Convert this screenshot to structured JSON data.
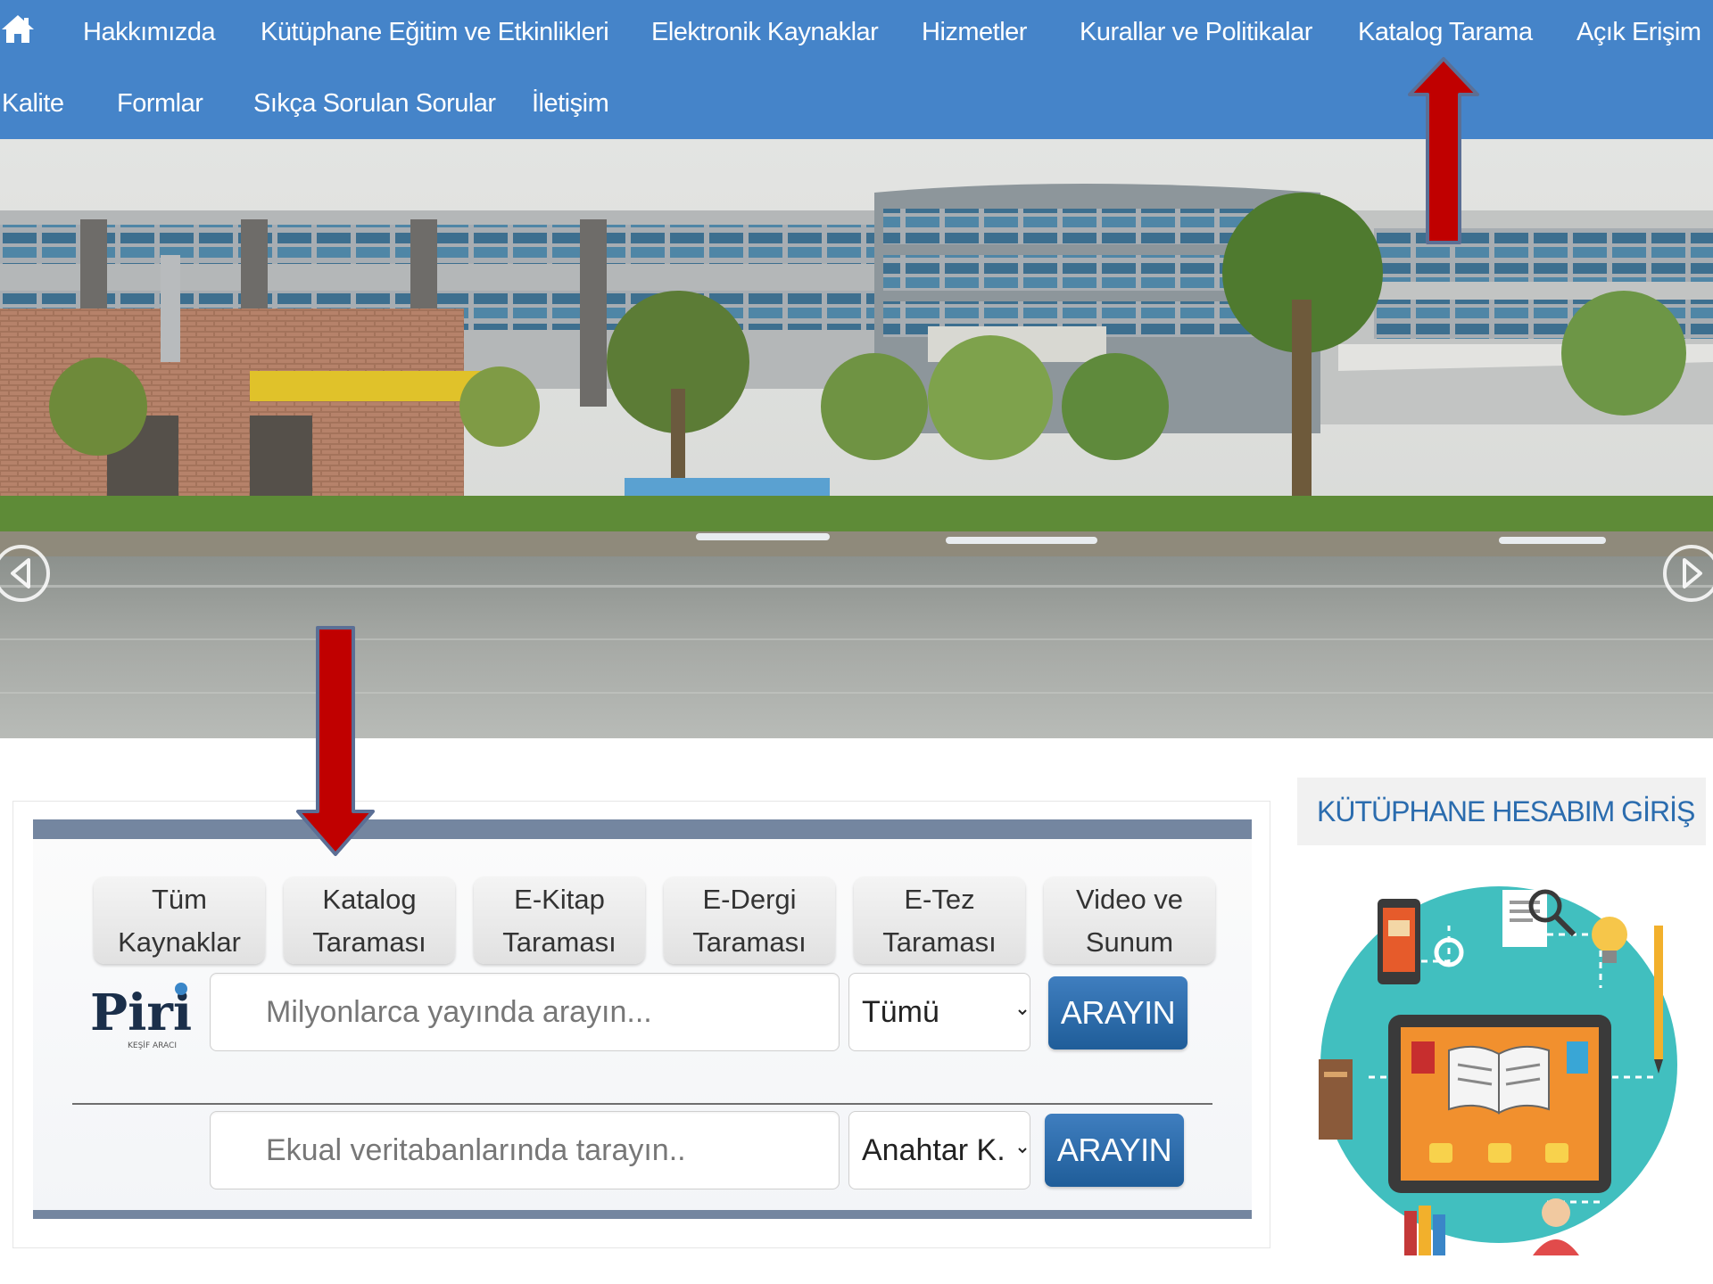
{
  "nav": {
    "row1": [
      "Hakkımızda",
      "Kütüphane Eğitim ve Etkinlikleri",
      "Elektronik Kaynaklar",
      "Hizmetler",
      "Kurallar ve Politikalar",
      "Katalog Tarama",
      "Açık Erişim"
    ],
    "row2": [
      "Kalite",
      "Formlar",
      "Sıkça Sorulan Sorular",
      "İletişim"
    ]
  },
  "search": {
    "tabs": [
      {
        "line1": "Tüm",
        "line2": "Kaynaklar",
        "active": true
      },
      {
        "line1": "Katalog",
        "line2": "Taraması",
        "active": false
      },
      {
        "line1": "E-Kitap",
        "line2": "Taraması",
        "active": false
      },
      {
        "line1": "E-Dergi",
        "line2": "Taraması",
        "active": false
      },
      {
        "line1": "E-Tez",
        "line2": "Taraması",
        "active": false
      },
      {
        "line1": "Video ve",
        "line2": "Sunum",
        "active": false
      }
    ],
    "logo_text": "Piri",
    "logo_subtext": "KEŞİF ARACI",
    "primary": {
      "placeholder": "Milyonlarca yayında arayın...",
      "select_value": "Tümü",
      "button": "ARAYIN"
    },
    "secondary": {
      "placeholder": "Ekual veritabanlarında tarayın..",
      "select_value": "Anahtar K.",
      "button": "ARAYIN"
    }
  },
  "account": {
    "title": "KÜTÜPHANE HESABIM GİRİŞ"
  },
  "colors": {
    "nav_bg": "#4584c9",
    "accent": "#2b6cae",
    "annotation_arrow": "#c00000"
  }
}
